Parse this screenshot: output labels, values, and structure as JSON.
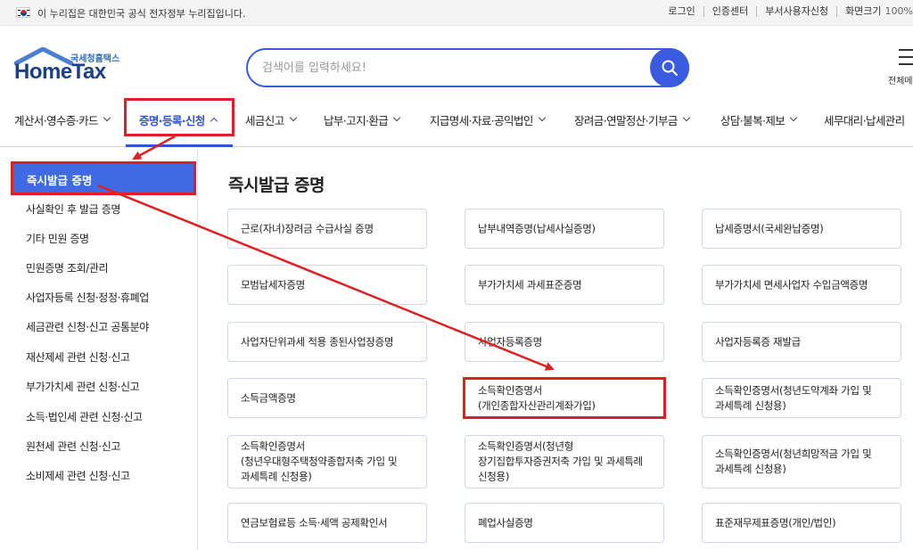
{
  "topbar": {
    "gov_notice": "이 누리집은 대한민국 공식 전자정부 누리집입니다.",
    "links": [
      "로그인",
      "인증센터",
      "부서사용자신청",
      "화면크기"
    ],
    "zoom": "100%"
  },
  "header": {
    "logo_sub": "국세청홈택스",
    "logo_main": "HomeTax",
    "search_placeholder": "검색어를 입력하세요!",
    "menu_all_label": "전체메뉴"
  },
  "gnb": {
    "items": [
      "계산서·영수증·카드",
      "증명·등록·신청",
      "세금신고",
      "납부·고지·환급",
      "지급명세·자료·공익법인",
      "장려금·연말정산·기부금",
      "상담·불복·제보",
      "세무대리·납세관리"
    ]
  },
  "sidebar": {
    "active": "즉시발급 증명",
    "items": [
      "사실확인 후 발급 증명",
      "기타 민원 증명",
      "민원증명 조회/관리",
      "사업자등록 신청·정정·휴폐업",
      "세금관련 신청·신고 공통분야",
      "재산제세 관련 신청·신고",
      "부가가치세 관련 신청·신고",
      "소득·법인세 관련 신청·신고",
      "원천세 관련 신청·신고",
      "소비제세 관련 신청·신고"
    ]
  },
  "main": {
    "title": "즉시발급 증명",
    "cards": [
      "근로(자녀)장려금 수급사실 증명",
      "납부내역증명(납세사실증명)",
      "납세증명서(국세완납증명)",
      "모범납세자증명",
      "부가가치세 과세표준증명",
      "부가가치세 면세사업자 수입금액증명",
      "사업자단위과세 적용 종된사업장증명",
      "사업자등록증명",
      "사업자등록증 재발급",
      "소득금액증명",
      "소득확인증명서(개인종합자산관리계좌가입)",
      "소득확인증명서(청년도약계좌 가입 및 과세특례 신청용)",
      "소득확인증명서(청년우대형주택청약종합저축 가입 및 과세특례 신청용)",
      "소득확인증명서(청년형 장기집합투자증권저축 가입 및 과세특례 신청용)",
      "소득확인증명서(청년희망적금 가입 및 과세특례 신청용)",
      "연금보험료등 소득·세액 공제확인서",
      "폐업사실증명",
      "표준재무제표증명(개인/법인)"
    ]
  },
  "colors": {
    "brand_blue": "#3a5be0",
    "active_blue": "#3f6ae3",
    "annotation_red": "#e02020"
  }
}
